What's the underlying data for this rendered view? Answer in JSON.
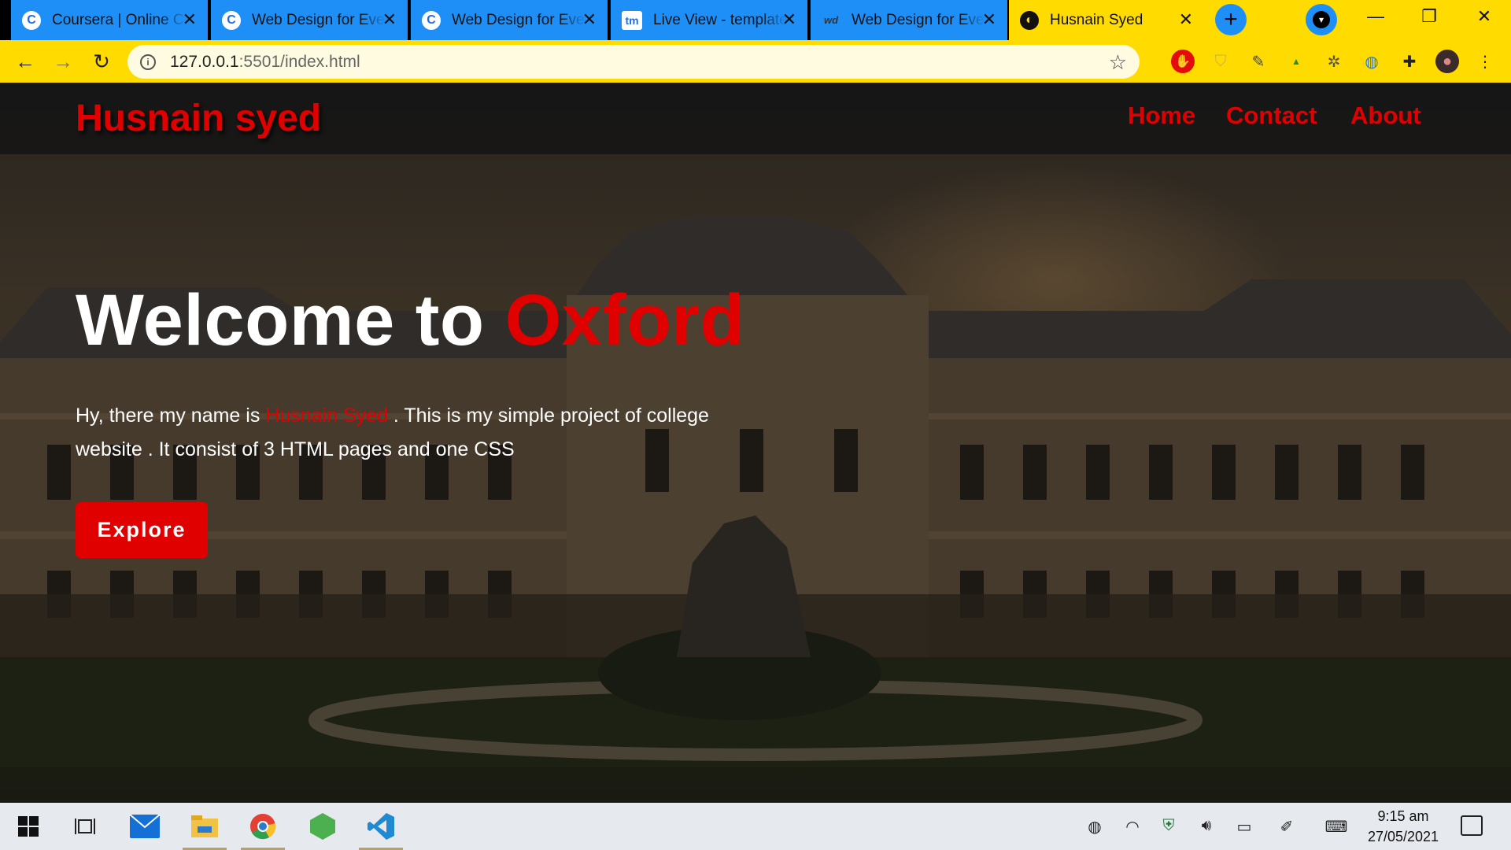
{
  "browser": {
    "tabs": [
      {
        "title": "Coursera | Online Courses",
        "favicon": "coursera-icon",
        "active": false
      },
      {
        "title": "Web Design for Everybody",
        "favicon": "coursera-icon",
        "active": false
      },
      {
        "title": "Web Design for Everybody",
        "favicon": "coursera-icon",
        "active": false
      },
      {
        "title": "Live View - templatemo",
        "favicon": "tm-icon",
        "active": false
      },
      {
        "title": "Web Design for Everybody",
        "favicon": "wd-icon",
        "active": false
      },
      {
        "title": "Husnain Syed",
        "favicon": "globe-icon",
        "active": true
      }
    ],
    "tab_close_glyph": "✕",
    "new_tab_glyph": "+",
    "url_host": "127.0.0.1",
    "url_path": ":5501/index.html"
  },
  "site": {
    "brand": "Husnain syed",
    "nav": {
      "home": "Home",
      "contact": "Contact",
      "about": "About"
    },
    "hero": {
      "title_prefix": "Welcome to ",
      "title_accent": "Oxford",
      "intro_before": "Hy, there my name is ",
      "intro_name": "Husnain Syed",
      "intro_after": " . This is my simple project of college website . It consist of 3 HTML pages and one CSS",
      "button": "Explore"
    },
    "colors": {
      "accent": "#e00000",
      "chrome": "#ffdb00",
      "tab": "#1e8ff7"
    }
  },
  "taskbar": {
    "apps": [
      "windows-start-icon",
      "task-view-icon",
      "mail-icon",
      "file-explorer-icon",
      "chrome-icon",
      "node-icon",
      "vscode-icon"
    ],
    "time": "9:15 am",
    "date": "27/05/2021"
  }
}
